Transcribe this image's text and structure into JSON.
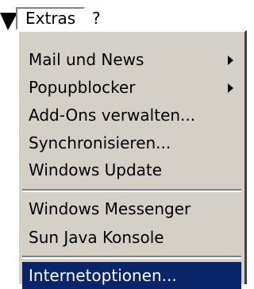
{
  "menubar": {
    "items": [
      {
        "label": "Extras",
        "open": true
      },
      {
        "label": "?",
        "open": false
      }
    ]
  },
  "menu": {
    "groups": [
      {
        "items": [
          {
            "label": "Mail und News",
            "submenu": true
          },
          {
            "label": "Popupblocker",
            "submenu": true
          },
          {
            "label": "Add-Ons verwalten...",
            "submenu": false
          },
          {
            "label": "Synchronisieren...",
            "submenu": false
          },
          {
            "label": "Windows Update",
            "submenu": false
          }
        ]
      },
      {
        "items": [
          {
            "label": "Windows Messenger",
            "submenu": false
          },
          {
            "label": "Sun Java Konsole",
            "submenu": false
          }
        ]
      },
      {
        "items": [
          {
            "label": "Internetoptionen...",
            "submenu": false,
            "selected": true
          }
        ]
      }
    ]
  },
  "colors": {
    "menu_background": "#d4d0c8",
    "highlight_background": "#0a246a",
    "highlight_text": "#ffffff"
  }
}
